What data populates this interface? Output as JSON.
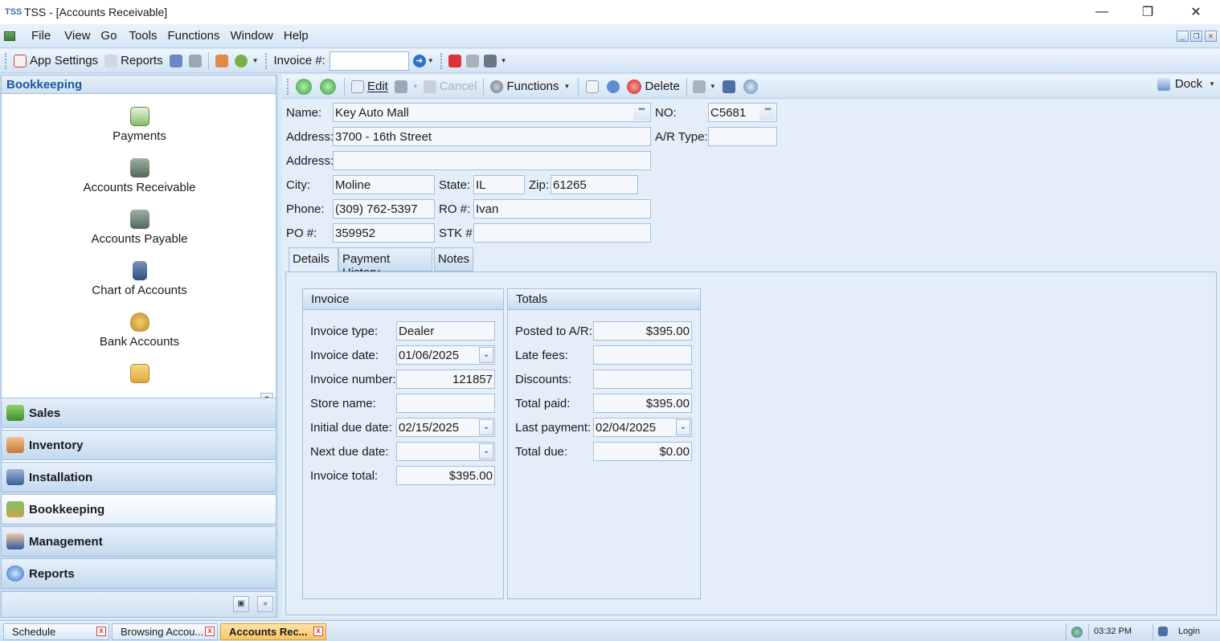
{
  "window": {
    "logo": "TSS",
    "title": "TSS - [Accounts Receivable]",
    "min": "—",
    "restore": "❐",
    "close": "✕"
  },
  "menu": [
    "File",
    "View",
    "Go",
    "Tools",
    "Functions",
    "Window",
    "Help"
  ],
  "toolbar1": {
    "app_settings": "App Settings",
    "reports": "Reports",
    "invoice_label": "Invoice #:",
    "invoice_value": ""
  },
  "toolbar2": {
    "edit": "Edit",
    "cancel": "Cancel",
    "functions": "Functions",
    "delete": "Delete",
    "dock": "Dock"
  },
  "nav": {
    "header": "Bookkeeping",
    "items": [
      "Payments",
      "Accounts Receivable",
      "Accounts Payable",
      "Chart of Accounts",
      "Bank Accounts"
    ],
    "groups": [
      "Sales",
      "Inventory",
      "Installation",
      "Bookkeeping",
      "Management",
      "Reports"
    ]
  },
  "customer": {
    "name_label": "Name:",
    "name": "Key Auto Mall",
    "no_label": "NO:",
    "no": "C5681",
    "address_label": "Address:",
    "address1": "3700 - 16th Street",
    "address2": "",
    "ar_type_label": "A/R Type:",
    "ar_type": "",
    "city_label": "City:",
    "city": "Moline",
    "state_label": "State:",
    "state": "IL",
    "zip_label": "Zip:",
    "zip": "61265",
    "phone_label": "Phone:",
    "phone": "(309) 762-5397",
    "ro_label": "RO #:",
    "ro": "Ivan",
    "po_label": "PO #:",
    "po": "359952",
    "stk_label": "STK #:",
    "stk": ""
  },
  "tabs": [
    "Details",
    "Payment History",
    "Notes"
  ],
  "invoice": {
    "header": "Invoice",
    "type_label": "Invoice type:",
    "type": "Dealer",
    "date_label": "Invoice date:",
    "date": "01/06/2025",
    "number_label": "Invoice number:",
    "number": "121857",
    "store_label": "Store name:",
    "store": "",
    "initial_due_label": "Initial due date:",
    "initial_due": "02/15/2025",
    "next_due_label": "Next due date:",
    "next_due": "",
    "total_label": "Invoice total:",
    "total": "$395.00"
  },
  "totals": {
    "header": "Totals",
    "posted_label": "Posted to A/R:",
    "posted": "$395.00",
    "late_fees_label": "Late fees:",
    "late_fees": "",
    "discounts_label": "Discounts:",
    "discounts": "",
    "total_paid_label": "Total paid:",
    "total_paid": "$395.00",
    "last_payment_label": "Last payment:",
    "last_payment": "02/04/2025",
    "total_due_label": "Total due:",
    "total_due": "$0.00"
  },
  "statusbar": {
    "tabs": [
      "Schedule",
      "Browsing Accou...",
      "Accounts Rec..."
    ],
    "time": "03:32 PM",
    "login": "Login"
  }
}
